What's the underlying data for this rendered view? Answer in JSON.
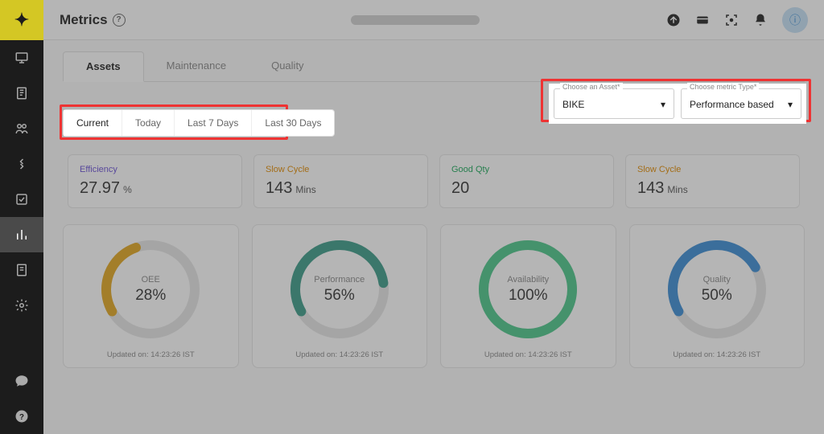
{
  "page_title": "Metrics",
  "main_tabs": [
    "Assets",
    "Maintenance",
    "Quality"
  ],
  "main_tab_active": 0,
  "range_tabs": [
    "Current",
    "Today",
    "Last 7 Days",
    "Last 30 Days"
  ],
  "range_tab_active": 0,
  "filters": {
    "asset": {
      "label": "Choose an Asset*",
      "value": "BIKE"
    },
    "metric": {
      "label": "Choose metric Type*",
      "value": "Performance based"
    }
  },
  "kpis": [
    {
      "label": "Efficiency",
      "value": "27.97",
      "unit": "%",
      "cls": "efficiency"
    },
    {
      "label": "Slow Cycle",
      "value": "143",
      "unit": "Mins",
      "cls": "slow"
    },
    {
      "label": "Good Qty",
      "value": "20",
      "unit": "",
      "cls": "good"
    },
    {
      "label": "Slow Cycle",
      "value": "143",
      "unit": "Mins",
      "cls": "slow"
    }
  ],
  "gauges": [
    {
      "label": "OEE",
      "value": "28%",
      "pct": 28,
      "color": "#e3a61f"
    },
    {
      "label": "Performance",
      "value": "56%",
      "pct": 56,
      "color": "#3a9b88"
    },
    {
      "label": "Availability",
      "value": "100%",
      "pct": 100,
      "color": "#4bc78a"
    },
    {
      "label": "Quality",
      "value": "50%",
      "pct": 50,
      "color": "#3a8dd6"
    }
  ],
  "updated_text": "Updated on: 14:23:26 IST",
  "chart_data": [
    {
      "type": "gauge",
      "title": "OEE",
      "value": 28,
      "max": 100,
      "unit": "%"
    },
    {
      "type": "gauge",
      "title": "Performance",
      "value": 56,
      "max": 100,
      "unit": "%"
    },
    {
      "type": "gauge",
      "title": "Availability",
      "value": 100,
      "max": 100,
      "unit": "%"
    },
    {
      "type": "gauge",
      "title": "Quality",
      "value": 50,
      "max": 100,
      "unit": "%"
    }
  ]
}
